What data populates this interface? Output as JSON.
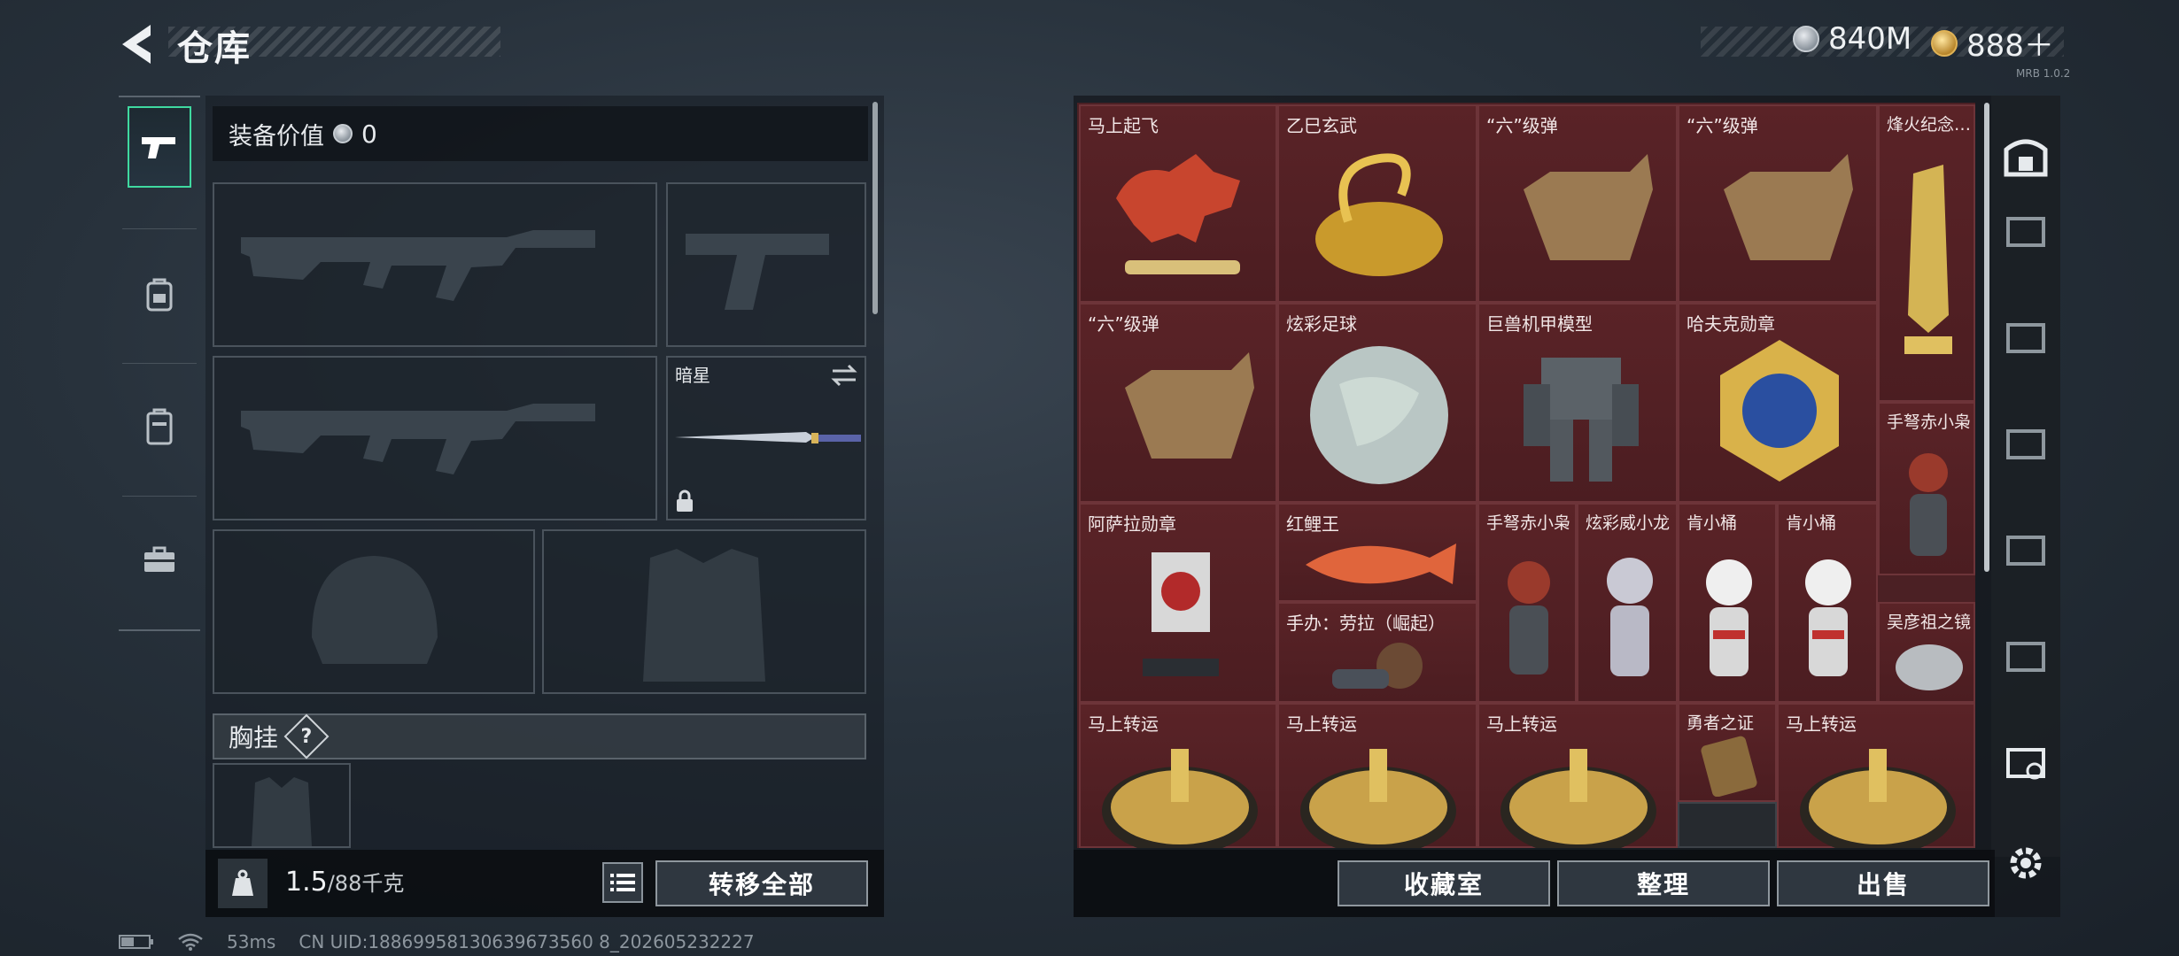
{
  "header": {
    "title": "仓库"
  },
  "currency": {
    "silver": "840M",
    "gold": "888＋",
    "version": "MRB 1.0.2"
  },
  "rail": {
    "items": [
      "weapons",
      "backpack",
      "armor",
      "toolbox"
    ]
  },
  "equipment": {
    "value_label": "装备价值",
    "value": "0",
    "melee_label": "暗星",
    "chest_label": "胸挂",
    "help_glyph": "?"
  },
  "weight": {
    "current": "1.5",
    "max": "/88千克"
  },
  "buttons": {
    "transfer_all": "转移全部",
    "collection": "收藏室",
    "organize": "整理",
    "sell": "出售"
  },
  "grid": {
    "items": [
      "马上起飞",
      "乙巳玄武",
      "“六”级弹",
      "“六”级弹",
      "烽火纪念…",
      "“六”级弹",
      "炫彩足球",
      "巨兽机甲模型",
      "哈夫克勋章",
      "手弩赤小枭",
      "阿萨拉勋章",
      "红鲤王",
      "手弩赤小枭",
      "炫彩威小龙",
      "肯小桶",
      "肯小桶",
      "手办：劳拉（崛起）",
      "吴彦祖之镜",
      "马上转运",
      "马上转运",
      "马上转运",
      "勇者之证",
      "马上转运"
    ]
  },
  "status": {
    "ping": "53ms",
    "uid": "CN UID:18869958130639673560 8_202605232227"
  }
}
